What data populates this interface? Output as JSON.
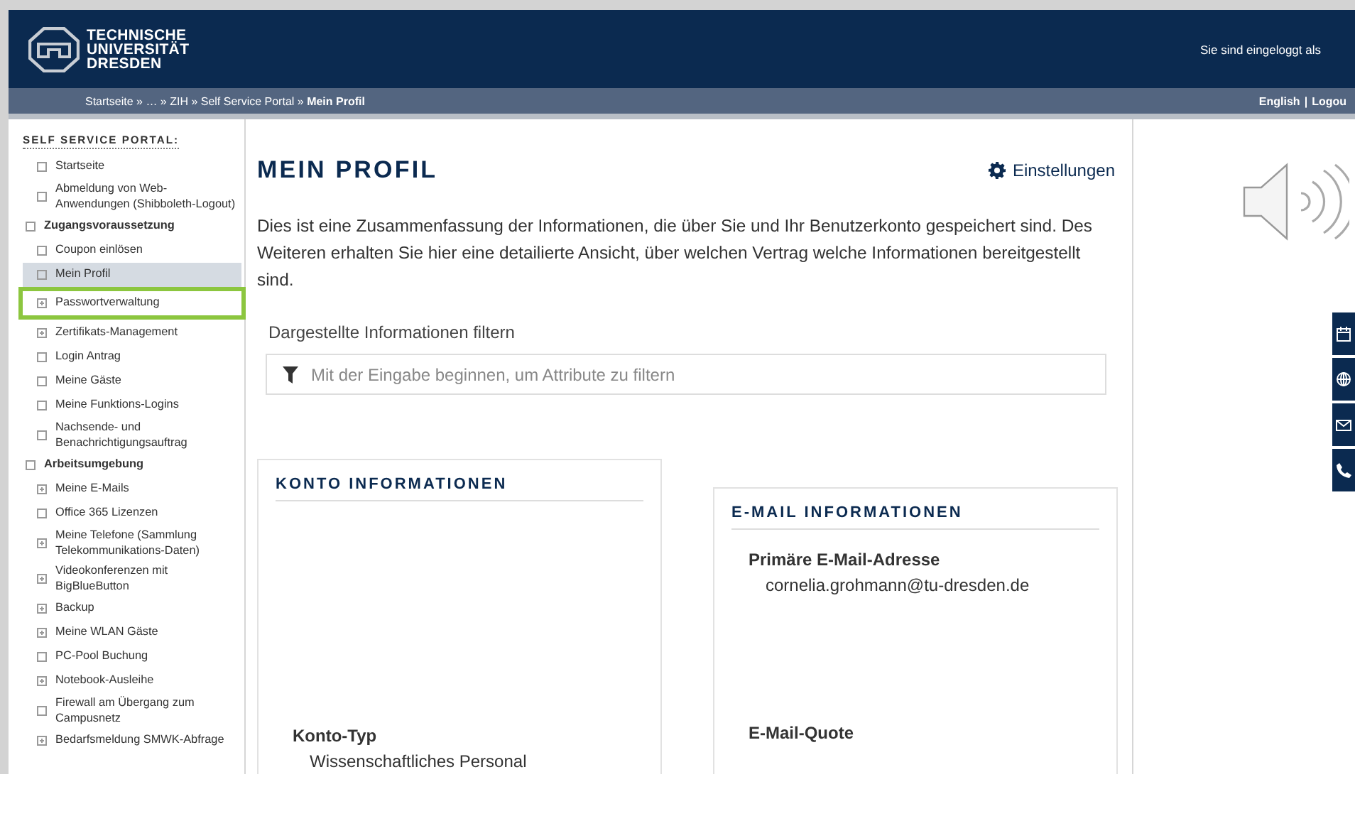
{
  "header": {
    "logo_lines": [
      "TECHNISCHE",
      "UNIVERSITÄT",
      "DRESDEN"
    ],
    "login_notice": "Sie sind eingeloggt als"
  },
  "breadcrumb": "Startseite » … » ZIH » Self Service Portal » **Mein Profil**",
  "top_links": {
    "links": [
      "English",
      "Logou"
    ],
    "separator": "|"
  },
  "sidebar": {
    "title": "SELF SERVICE PORTAL:",
    "items": [
      {
        "label": "Startseite",
        "kind": "page",
        "selected": false,
        "highlighted": false
      },
      {
        "label": "Abmeldung von Web-Anwendungen (Shibboleth-Logout)",
        "kind": "page",
        "selected": false,
        "highlighted": false
      },
      {
        "label": "Zugangsvoraussetzung",
        "kind": "group",
        "selected": false,
        "highlighted": false,
        "children": [
          {
            "label": "Coupon einlösen",
            "kind": "page",
            "selected": false,
            "highlighted": false
          },
          {
            "label": "Mein Profil",
            "kind": "page",
            "selected": true,
            "highlighted": false
          },
          {
            "label": "Passwortverwaltung",
            "kind": "expandable",
            "selected": false,
            "highlighted": true
          },
          {
            "label": "Zertifikats-Management",
            "kind": "expandable",
            "selected": false,
            "highlighted": false
          },
          {
            "label": "Login Antrag",
            "kind": "page",
            "selected": false,
            "highlighted": false
          },
          {
            "label": "Meine Gäste",
            "kind": "page",
            "selected": false,
            "highlighted": false
          },
          {
            "label": "Meine Funktions-Logins",
            "kind": "page",
            "selected": false,
            "highlighted": false
          },
          {
            "label": "Nachsende- und Benachrichtigungsauftrag",
            "kind": "page",
            "selected": false,
            "highlighted": false
          }
        ]
      },
      {
        "label": "Arbeitsumgebung",
        "kind": "group",
        "selected": false,
        "highlighted": false,
        "children": [
          {
            "label": "Meine E-Mails",
            "kind": "expandable",
            "selected": false,
            "highlighted": false
          },
          {
            "label": "Office 365 Lizenzen",
            "kind": "page",
            "selected": false,
            "highlighted": false
          },
          {
            "label": "Meine Telefone (Sammlung Telekommunikations-Daten)",
            "kind": "expandable",
            "selected": false,
            "highlighted": false
          },
          {
            "label": "Videokonferenzen mit BigBlueButton",
            "kind": "expandable",
            "selected": false,
            "highlighted": false
          },
          {
            "label": "Backup",
            "kind": "expandable",
            "selected": false,
            "highlighted": false
          },
          {
            "label": "Meine WLAN Gäste",
            "kind": "expandable",
            "selected": false,
            "highlighted": false
          },
          {
            "label": "PC-Pool Buchung",
            "kind": "page",
            "selected": false,
            "highlighted": false
          },
          {
            "label": "Notebook-Ausleihe",
            "kind": "expandable",
            "selected": false,
            "highlighted": false
          },
          {
            "label": "Firewall am Übergang zum Campusnetz",
            "kind": "page",
            "selected": false,
            "highlighted": false
          },
          {
            "label": "Bedarfsmeldung SMWK-Abfrage",
            "kind": "expandable",
            "selected": false,
            "highlighted": false
          }
        ]
      }
    ]
  },
  "main": {
    "title": "MEIN PROFIL",
    "settings_link": "Einstellungen",
    "intro": "Dies ist eine Zusammenfassung der Informationen, die über Sie und Ihr Benutzerkonto gespeichert sind. Des Weiteren erhalten Sie hier eine detailierte Ansicht, über welchen Vertrag welche Informationen bereitgestellt sind.",
    "filter": {
      "label": "Dargestellte Informationen filtern",
      "placeholder": "Mit der Eingabe beginnen, um Attribute zu filtern"
    },
    "cards": [
      {
        "title": "KONTO INFORMATIONEN",
        "fields": [
          {
            "label": "Konto-Typ",
            "value": "Wissenschaftliches Personal"
          }
        ]
      },
      {
        "title": "E-MAIL INFORMATIONEN",
        "fields": [
          {
            "label": "Primäre E-Mail-Adresse",
            "value": "cornelia.grohmann@tu-dresden.de"
          },
          {
            "label": "E-Mail-Quote"
          }
        ]
      }
    ]
  },
  "quick_actions": [
    {
      "kind": "calendar"
    },
    {
      "kind": "globe"
    },
    {
      "kind": "mail"
    },
    {
      "kind": "phone"
    }
  ]
}
